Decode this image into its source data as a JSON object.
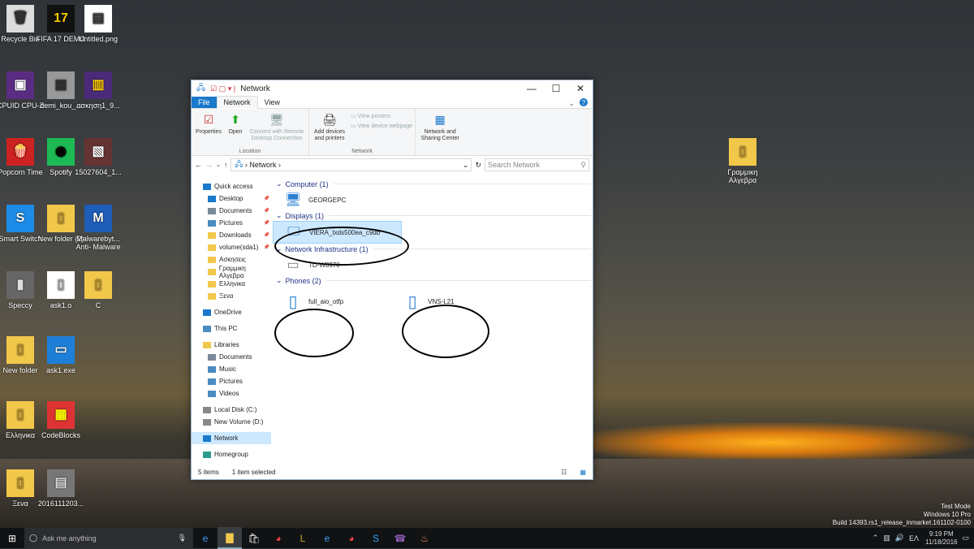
{
  "desktop": {
    "icons": [
      {
        "label": "Recycle Bin",
        "glyph": "🗑"
      },
      {
        "label": "FIFA 17 DEMO",
        "glyph": "17"
      },
      {
        "label": "Untitled.png",
        "glyph": "▤"
      },
      {
        "label": "CPUID CPU-Z",
        "glyph": "▣"
      },
      {
        "label": "demi_kou_...",
        "glyph": "▦"
      },
      {
        "label": "ασκηση1_9...",
        "glyph": "▥"
      },
      {
        "label": "Popcorn Time",
        "glyph": "🍿"
      },
      {
        "label": "Spotify",
        "glyph": "◉"
      },
      {
        "label": "15027604_1...",
        "glyph": "▧"
      },
      {
        "label": "Smart Switch",
        "glyph": "S"
      },
      {
        "label": "New folder (2)",
        "glyph": "▯"
      },
      {
        "label": "Malwarebyt... Anti- Malware",
        "glyph": "M"
      },
      {
        "label": "Speccy",
        "glyph": "▮"
      },
      {
        "label": "ask1.o",
        "glyph": "▯"
      },
      {
        "label": "C",
        "glyph": "▯"
      },
      {
        "label": "New folder",
        "glyph": "▯"
      },
      {
        "label": "ask1.exe",
        "glyph": "▭"
      },
      {
        "label": "Ελληνικα",
        "glyph": "▯"
      },
      {
        "label": "CodeBlocks",
        "glyph": "▦"
      },
      {
        "label": "Ξενα",
        "glyph": "▯"
      },
      {
        "label": "2016111203...",
        "glyph": "▤"
      },
      {
        "label": "Γραμμικη Αλγεβρα",
        "glyph": "▯"
      }
    ]
  },
  "window": {
    "title": "Network",
    "controls": {
      "minimize": "—",
      "maximize": "☐",
      "close": "✕"
    },
    "tabs": {
      "file": "File",
      "network": "Network",
      "view": "View"
    },
    "help": "?",
    "ribbon": {
      "location": {
        "label": "Location",
        "properties": "Properties",
        "open": "Open",
        "connect": "Connect with Remote Desktop Connection"
      },
      "network": {
        "label": "Network",
        "add_devices": "Add devices and printers",
        "view_printers": "View printers",
        "view_device_webpage": "View device webpage"
      },
      "center": {
        "sharing": "Network and Sharing Center"
      }
    },
    "address": {
      "path": "Network",
      "search_placeholder": "Search Network"
    },
    "nav": [
      {
        "label": "Quick access",
        "kind": "star"
      },
      {
        "label": "Desktop",
        "kind": "folder-blue",
        "pin": true
      },
      {
        "label": "Documents",
        "kind": "doc",
        "pin": true
      },
      {
        "label": "Pictures",
        "kind": "pic",
        "pin": true
      },
      {
        "label": "Downloads",
        "kind": "folder",
        "pin": true
      },
      {
        "label": "volume(sda1)",
        "kind": "folder",
        "pin": true
      },
      {
        "label": "Ασκησεις",
        "kind": "folder"
      },
      {
        "label": "Γραμμικη Αλγεβρα",
        "kind": "folder"
      },
      {
        "label": "Ελληνικα",
        "kind": "folder"
      },
      {
        "label": "Ξενα",
        "kind": "folder"
      },
      {
        "label": "OneDrive",
        "kind": "cloud"
      },
      {
        "label": "This PC",
        "kind": "pc"
      },
      {
        "label": "Libraries",
        "kind": "lib"
      },
      {
        "label": "Documents",
        "kind": "doc"
      },
      {
        "label": "Music",
        "kind": "music"
      },
      {
        "label": "Pictures",
        "kind": "pic"
      },
      {
        "label": "Videos",
        "kind": "video"
      },
      {
        "label": "Local Disk (C:)",
        "kind": "disk"
      },
      {
        "label": "New Volume (D:)",
        "kind": "disk"
      },
      {
        "label": "Network",
        "kind": "net",
        "selected": true
      },
      {
        "label": "Homegroup",
        "kind": "home"
      }
    ],
    "groups": [
      {
        "header": "Computer (1)",
        "items": [
          {
            "label": "GEORGEPC",
            "kind": "pc"
          }
        ]
      },
      {
        "header": "Displays (1)",
        "items": [
          {
            "label": "VIERA_txds500ea_c9db",
            "kind": "display",
            "selected": true
          }
        ]
      },
      {
        "header": "Network Infrastructure (1)",
        "items": [
          {
            "label": "TD-W8970",
            "kind": "router"
          }
        ]
      },
      {
        "header": "Phones (2)",
        "items": [
          {
            "label": "full_aio_otfp",
            "kind": "phone"
          },
          {
            "label": "VNS-L21",
            "kind": "phone"
          }
        ]
      }
    ],
    "status": {
      "count": "5 items",
      "selected": "1 item selected"
    }
  },
  "taskbar": {
    "search_placeholder": "Ask me anything",
    "tray": {
      "lang": "ΕΛ",
      "time": "9:19 PM",
      "date": "11/18/2016"
    }
  },
  "watermark": {
    "line1": "Test Mode",
    "line2": "Windows 10 Pro",
    "line3": "Build 14393.rs1_release_inmarket.161102-0100"
  },
  "colors": {
    "accent": "#1979ca",
    "selection": "#cce8ff",
    "group_header": "#1e3287"
  }
}
